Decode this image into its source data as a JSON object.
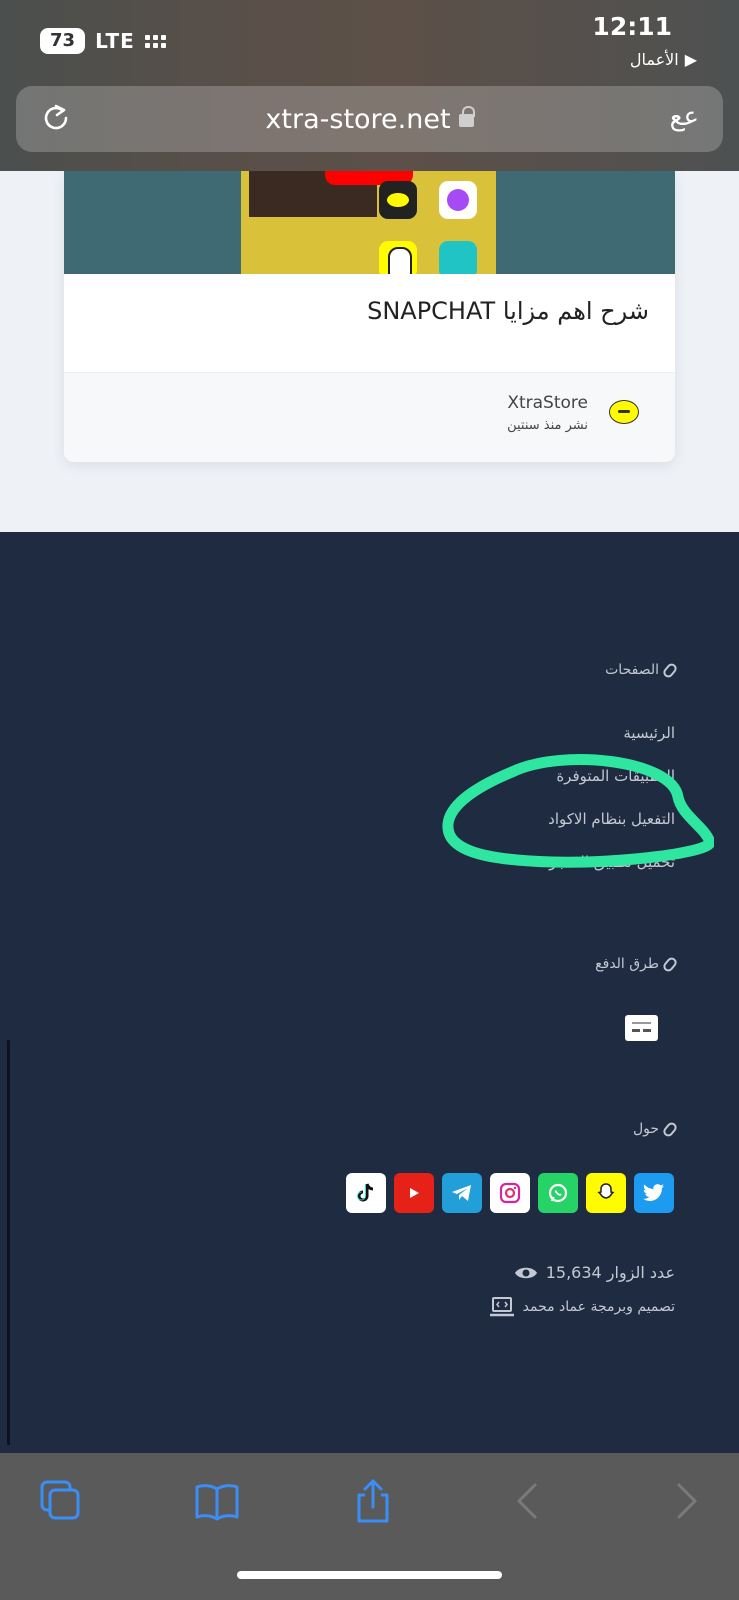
{
  "status": {
    "time": "12:11",
    "back_app": "الأعمال",
    "battery": "73",
    "network": "LTE"
  },
  "browser": {
    "url": "xtra-store.net",
    "text_size_button": "عع"
  },
  "article": {
    "title": "شرح اهم مزايا SNAPCHAT",
    "author": "XtraStore",
    "posted": "نشر منذ سنتين"
  },
  "footer": {
    "pages": {
      "title": "الصفحات",
      "links": [
        "الرئيسية",
        "التطبيقات المتوفرة",
        "التفعيل بنظام الاكواد",
        "تحميل تطبيق المتجر"
      ]
    },
    "payment": {
      "title": "طرق الدفع"
    },
    "about": {
      "title": "حول",
      "socials": [
        {
          "name": "twitter",
          "color": "#1d9bf0"
        },
        {
          "name": "snapchat",
          "color": "#fffc00"
        },
        {
          "name": "whatsapp",
          "color": "#25d366"
        },
        {
          "name": "instagram",
          "color": "#ffffff"
        },
        {
          "name": "telegram",
          "color": "#229ed9"
        },
        {
          "name": "youtube",
          "color": "#e62117"
        },
        {
          "name": "tiktok",
          "color": "#ffffff"
        }
      ]
    },
    "visitors": "عدد الزوار 15,634",
    "credit": "تصميم وبرمجة عماد محمد"
  },
  "colors": {
    "footer_bg": "#1f2b40",
    "highlight": "#2ee6a0",
    "toolbar_icon": "#3b8ef5"
  }
}
